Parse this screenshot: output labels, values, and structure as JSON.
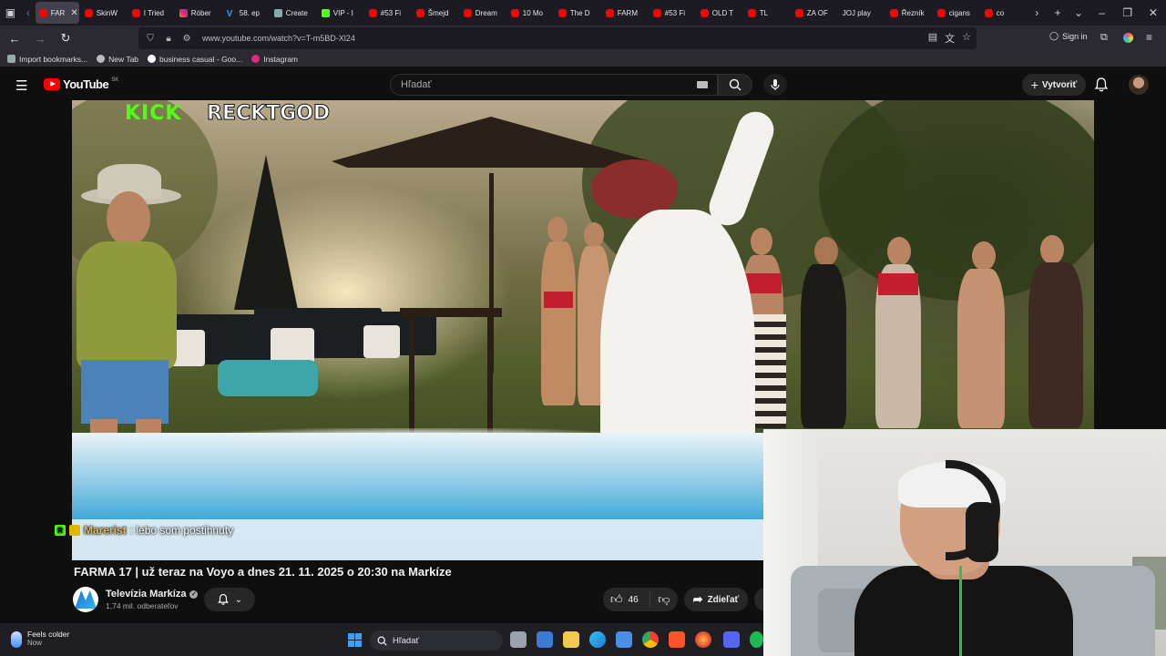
{
  "browser": {
    "tabs": [
      {
        "label": "FAR",
        "icon": "youtube-icon",
        "active": true
      },
      {
        "label": "SkinW",
        "icon": "youtube-icon"
      },
      {
        "label": "I Tried",
        "icon": "youtube-icon"
      },
      {
        "label": "Róber",
        "icon": "instagram-icon"
      },
      {
        "label": "58. ep",
        "icon": "v-icon"
      },
      {
        "label": "Create",
        "icon": "create-icon"
      },
      {
        "label": "VIP - I",
        "icon": "kick-icon"
      },
      {
        "label": "#53 Fi",
        "icon": "youtube-icon"
      },
      {
        "label": "Šmejd",
        "icon": "youtube-icon"
      },
      {
        "label": "Dream",
        "icon": "youtube-icon"
      },
      {
        "label": "10 Mo",
        "icon": "youtube-icon"
      },
      {
        "label": "The D",
        "icon": "youtube-icon"
      },
      {
        "label": "FARM",
        "icon": "youtube-icon"
      },
      {
        "label": "#53 Fi",
        "icon": "youtube-icon"
      },
      {
        "label": "OLD T",
        "icon": "youtube-icon"
      },
      {
        "label": "TL",
        "icon": "youtube-icon"
      },
      {
        "label": "ZA OF",
        "icon": "youtube-icon"
      },
      {
        "label": "JOJ play",
        "icon": "joj-icon"
      },
      {
        "label": "Řezník",
        "icon": "youtube-icon"
      },
      {
        "label": "cigans",
        "icon": "youtube-icon"
      },
      {
        "label": "co",
        "icon": "youtube-icon"
      }
    ],
    "url": "www.youtube.com/watch?v=T-m5BD-Xl24",
    "sign_in": "Sign in",
    "bookmarks": [
      {
        "label": "Import bookmarks...",
        "icon": "import-icon"
      },
      {
        "label": "New Tab",
        "icon": "globe-icon"
      },
      {
        "label": "business casual - Goo...",
        "icon": "google-icon"
      },
      {
        "label": "Instagram",
        "icon": "instagram-icon"
      }
    ]
  },
  "youtube": {
    "logo_text": "YouTube",
    "country_code": "SK",
    "search_placeholder": "Hľadať",
    "create_label": "Vytvoriť"
  },
  "video": {
    "overlay_platform": "KICK",
    "overlay_streamer": "RECKTGOD",
    "chat_badge_text": "R",
    "chat_user": "Marerist",
    "chat_message": ": lebo som postihnuty",
    "title": "FARMA 17 | už teraz na Voyo a dnes 21. 11. 2025 o 20:30 na Markíze",
    "channel_name": "Televízia Markíza",
    "subscribers": "1,74 mil. odberateľov",
    "likes": "46",
    "share_label": "Zdieľať"
  },
  "taskbar": {
    "weather_title": "Feels colder",
    "weather_sub": "Now",
    "search_placeholder": "Hľadať"
  },
  "colors": {
    "youtube_red": "#ff0000",
    "kick_green": "#53fc18",
    "background": "#0f0f0f"
  }
}
